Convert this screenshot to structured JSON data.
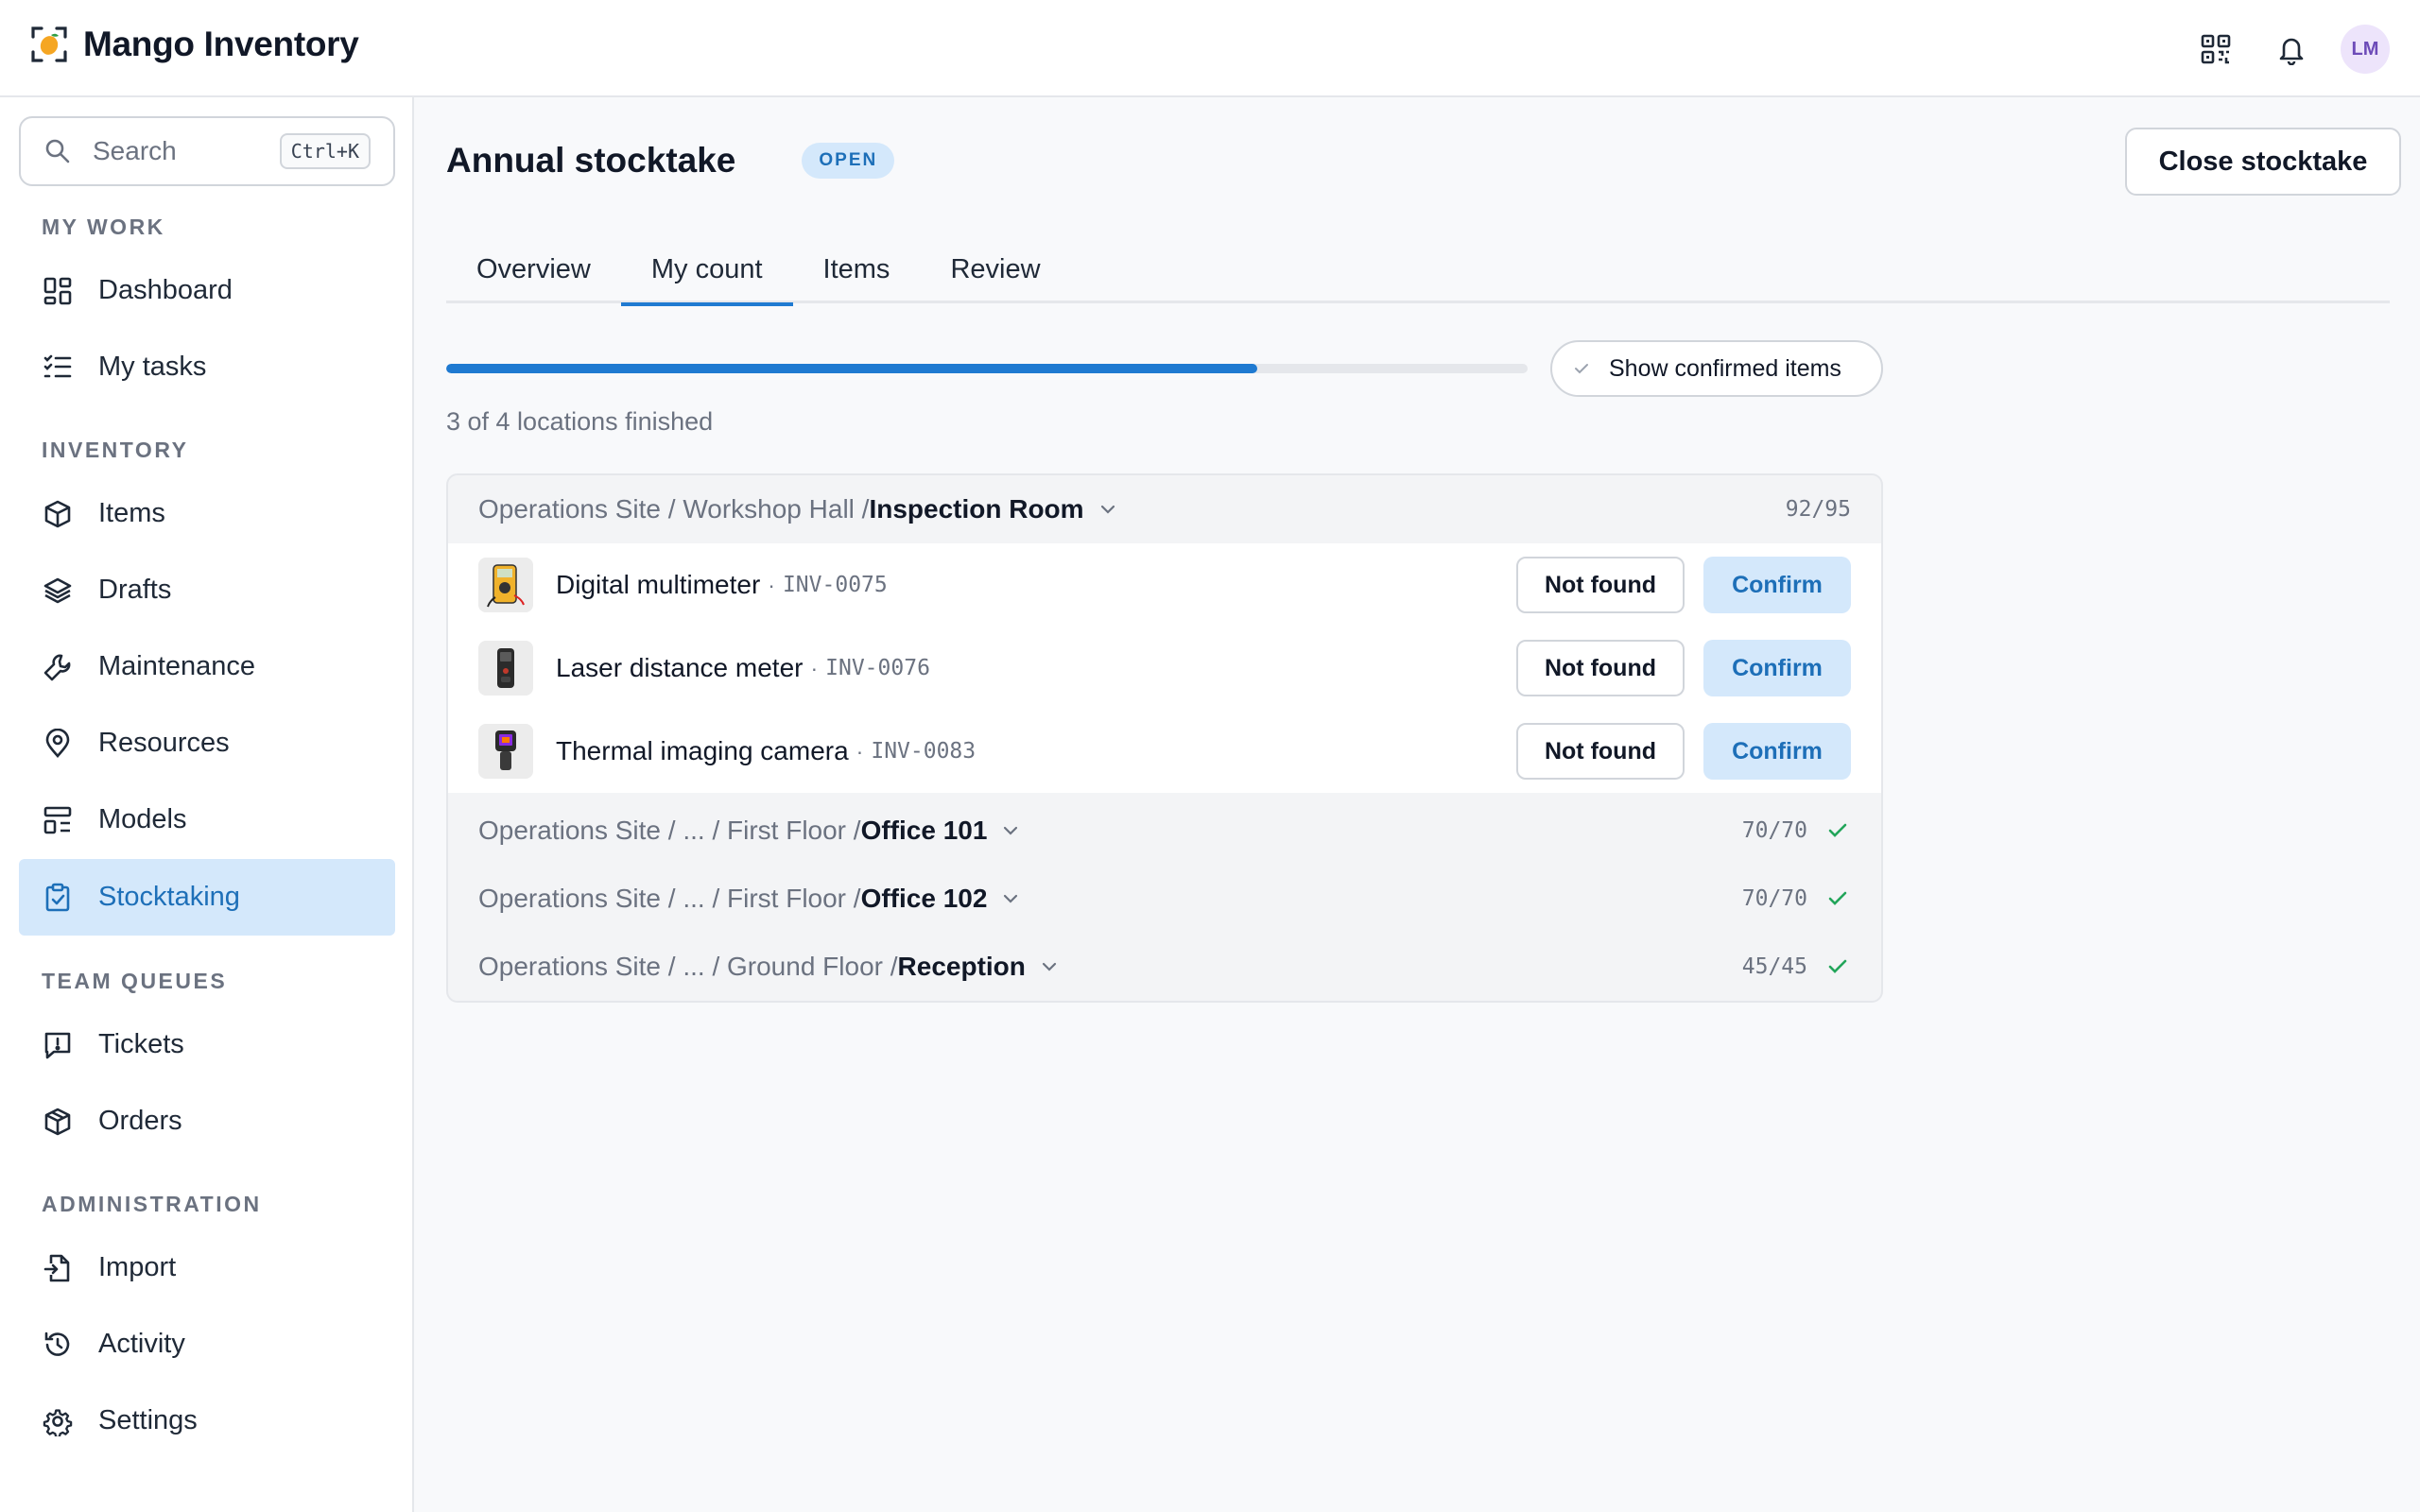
{
  "app": {
    "name": "Mango Inventory",
    "avatar_initials": "LM"
  },
  "header": {
    "icons": [
      "qr-code-icon",
      "bell-icon"
    ]
  },
  "sidebar": {
    "search_placeholder": "Search",
    "search_shortcut": "Ctrl+K",
    "sections": {
      "my_work": "MY WORK",
      "inventory": "INVENTORY",
      "team_queues": "TEAM QUEUES",
      "administration": "ADMINISTRATION"
    },
    "items": {
      "dashboard": "Dashboard",
      "my_tasks": "My tasks",
      "items": "Items",
      "drafts": "Drafts",
      "maintenance": "Maintenance",
      "resources": "Resources",
      "models": "Models",
      "stocktaking": "Stocktaking",
      "tickets": "Tickets",
      "orders": "Orders",
      "import": "Import",
      "activity": "Activity",
      "settings": "Settings"
    },
    "active": "stocktaking"
  },
  "page": {
    "title": "Annual stocktake",
    "status": "OPEN",
    "close_button": "Close stocktake",
    "tabs": [
      "Overview",
      "My count",
      "Items",
      "Review"
    ],
    "active_tab": "My count",
    "progress": {
      "fraction": 0.75,
      "text": "3 of 4 locations finished"
    },
    "show_confirmed_label": "Show confirmed items"
  },
  "locations": [
    {
      "path": "Operations Site / Workshop Hall / ",
      "leaf": "Inspection Room",
      "count": "92/95",
      "complete": false,
      "items": [
        {
          "name": "Digital multimeter",
          "code": "INV-0075"
        },
        {
          "name": "Laser distance meter",
          "code": "INV-0076"
        },
        {
          "name": "Thermal imaging camera",
          "code": "INV-0083"
        }
      ]
    },
    {
      "path": "Operations Site / ... / First Floor / ",
      "leaf": "Office 101",
      "count": "70/70",
      "complete": true
    },
    {
      "path": "Operations Site / ... / First Floor / ",
      "leaf": "Office 102",
      "count": "70/70",
      "complete": true
    },
    {
      "path": "Operations Site / ... / Ground Floor / ",
      "leaf": "Reception",
      "count": "45/45",
      "complete": true
    }
  ],
  "item_actions": {
    "not_found": "Not found",
    "confirm": "Confirm",
    "separator": "·"
  },
  "colors": {
    "accent": "#1f7ad1",
    "accent_soft": "#d4e8fb",
    "success": "#22a55a",
    "brand_orange": "#f5a623"
  }
}
